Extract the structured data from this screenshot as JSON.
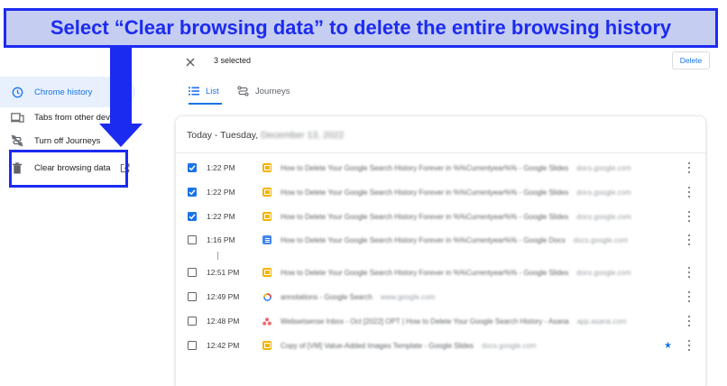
{
  "banner": {
    "text": "Select “Clear browsing data” to delete the entire browsing history"
  },
  "sidebar": {
    "items": [
      {
        "label": "Chrome history",
        "icon": "clock-icon",
        "active": true
      },
      {
        "label": "Tabs from other devices",
        "icon": "devices-icon"
      },
      {
        "label": "Turn off Journeys",
        "icon": "journeys-off-icon"
      },
      {
        "label": "Clear browsing data",
        "icon": "trash-icon",
        "trailing_icon": "open-in-new-icon"
      }
    ]
  },
  "toolbar": {
    "selected_count": "3 selected",
    "delete_label": "Delete"
  },
  "tabs": [
    {
      "label": "List",
      "active": true
    },
    {
      "label": "Journeys"
    }
  ],
  "history": {
    "date_prefix": "Today - Tuesday,",
    "date_blurred": "December 13, 2022",
    "rows": [
      {
        "checked": true,
        "time": "1:22 PM",
        "favicon": "slides",
        "title": "How to Delete Your Google Search History Forever in %%Currentyear%% - Google Slides",
        "domain": "docs.google.com",
        "starred": false
      },
      {
        "checked": true,
        "time": "1:22 PM",
        "favicon": "slides",
        "title": "How to Delete Your Google Search History Forever in %%Currentyear%% - Google Slides",
        "domain": "docs.google.com",
        "starred": false
      },
      {
        "checked": true,
        "time": "1:22 PM",
        "favicon": "slides",
        "title": "How to Delete Your Google Search History Forever in %%Currentyear%% - Google Slides",
        "domain": "docs.google.com",
        "starred": false
      },
      {
        "checked": false,
        "time": "1:16 PM",
        "favicon": "docs",
        "title": "How to Delete Your Google Search History Forever in %%Currentyear%% - Google Docs",
        "domain": "docs.google.com",
        "starred": false
      },
      {
        "checked": false,
        "time": "12:51 PM",
        "favicon": "slides",
        "title": "How to Delete Your Google Search History Forever in %%Currentyear%% - Google Slides",
        "domain": "docs.google.com",
        "starred": false
      },
      {
        "checked": false,
        "time": "12:49 PM",
        "favicon": "google",
        "title": "annotations - Google Search",
        "domain": "www.google.com",
        "starred": false
      },
      {
        "checked": false,
        "time": "12:48 PM",
        "favicon": "asana",
        "title": "Websetsense Inbox - Oct [2022] OPT | How to Delete Your Google Search History - Asana",
        "domain": "app.asana.com",
        "starred": false
      },
      {
        "checked": false,
        "time": "12:42 PM",
        "favicon": "slides",
        "title": "Copy of [VM] Value-Added Images Template - Google Slides",
        "domain": "docs.google.com",
        "starred": true
      }
    ]
  },
  "colors": {
    "accent": "#1a73e8",
    "annotation_blue": "#1c2bf0",
    "banner_bg": "#c5cdf1",
    "slides_yellow": "#f4b400",
    "docs_blue": "#4285f4",
    "asana_red": "#f06a6a"
  }
}
